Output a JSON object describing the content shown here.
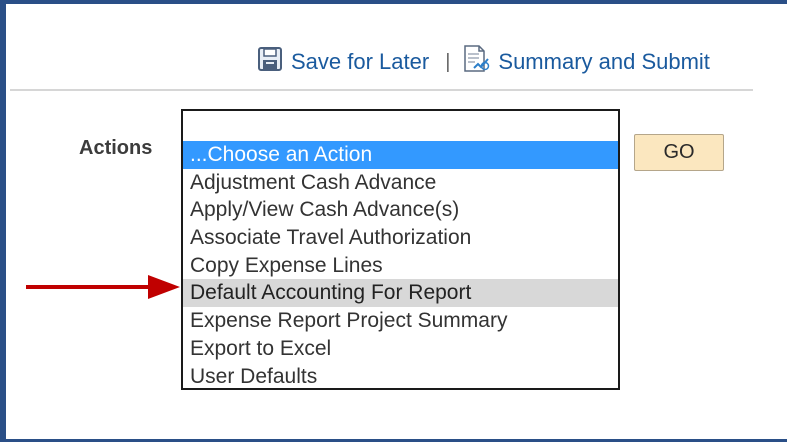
{
  "toolbar": {
    "save_label": "Save for Later",
    "separator": "|",
    "submit_label": "Summary and Submit",
    "save_icon": "floppy-disk-icon",
    "submit_icon": "document-submit-icon",
    "link_color": "#1a5a9e"
  },
  "actions": {
    "label": "Actions",
    "options": [
      "...Choose an Action",
      "Adjustment Cash Advance",
      "Apply/View Cash Advance(s)",
      "Associate Travel Authorization",
      "Copy Expense Lines",
      "Default Accounting For Report",
      "Expense Report Project Summary",
      "Export to Excel",
      "User Defaults"
    ],
    "selected_index": 0,
    "highlighted_index": 5,
    "go_label": "GO",
    "selected_color": "#3399ff",
    "highlight_color": "#d8d8d8"
  },
  "annotation": {
    "arrow_icon": "red-arrow-icon",
    "arrow_color": "#c00000"
  }
}
